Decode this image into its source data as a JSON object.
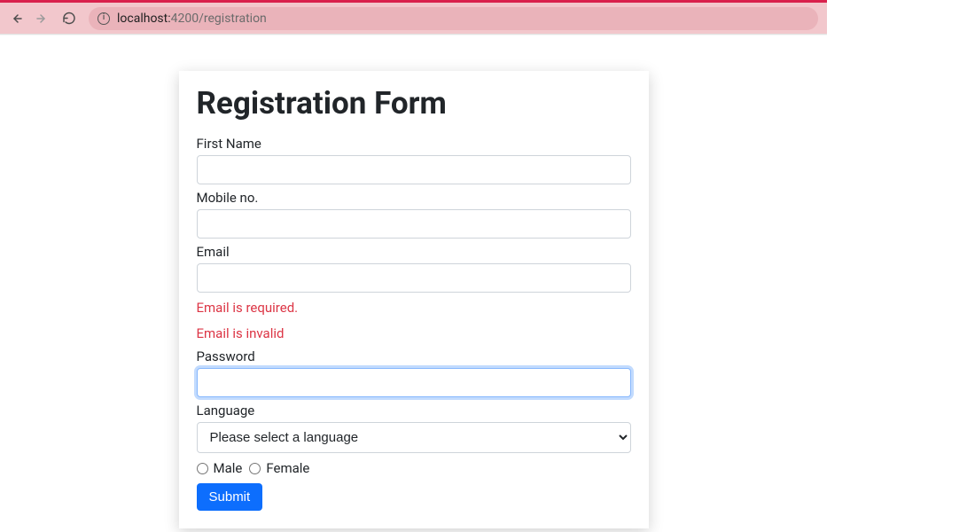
{
  "browser": {
    "url_host": "localhost:",
    "url_port_path": "4200/registration"
  },
  "form": {
    "title": "Registration Form",
    "firstName": {
      "label": "First Name",
      "value": ""
    },
    "mobile": {
      "label": "Mobile no.",
      "value": ""
    },
    "email": {
      "label": "Email",
      "value": "",
      "errors": {
        "required": "Email is required.",
        "invalid": "Email is invalid"
      }
    },
    "password": {
      "label": "Password",
      "value": ""
    },
    "language": {
      "label": "Language",
      "selected": "Please select a language"
    },
    "gender": {
      "male": "Male",
      "female": "Female"
    },
    "submit": "Submit"
  }
}
